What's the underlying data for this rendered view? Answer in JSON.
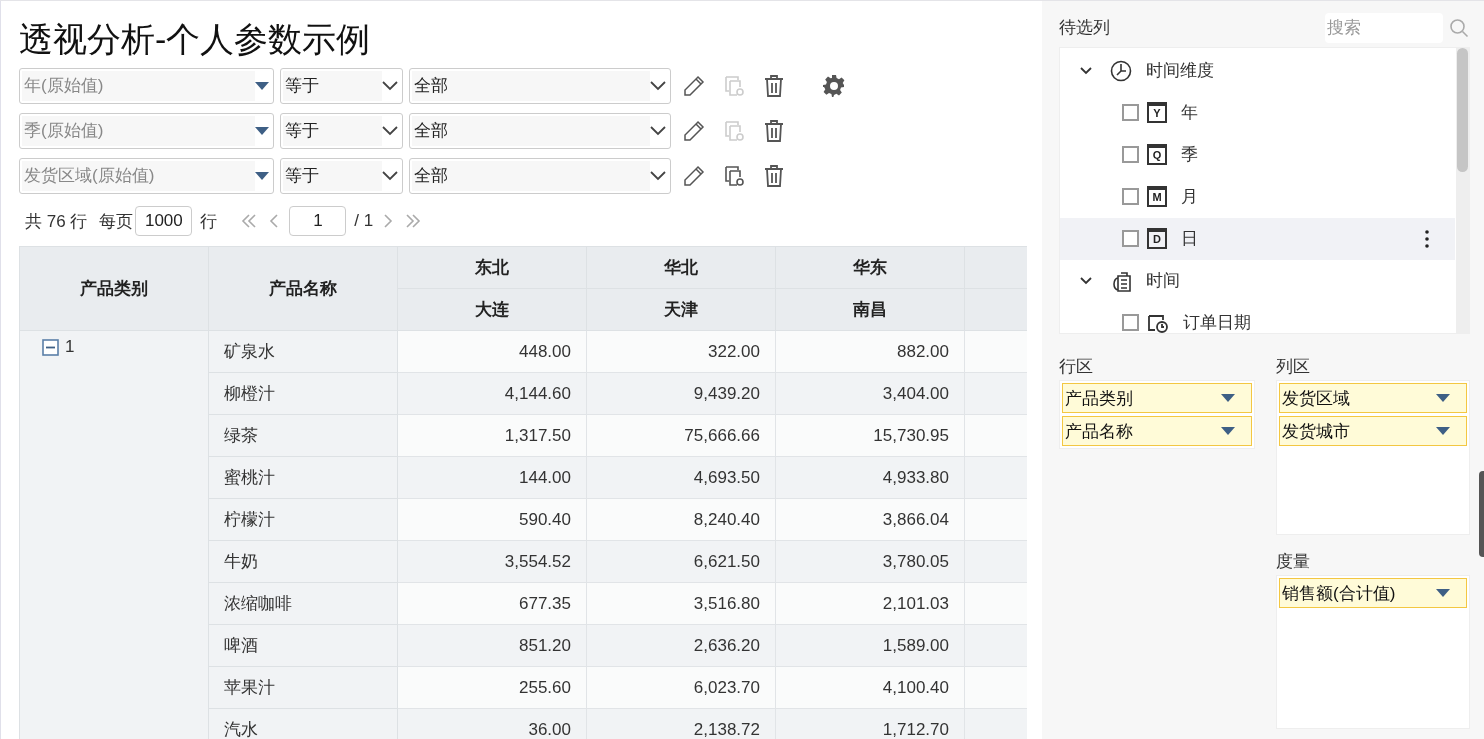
{
  "title": "透视分析-个人参数示例",
  "filters": [
    {
      "field": "年(原始值)",
      "operator": "等于",
      "value": "全部",
      "copy_disabled": true,
      "has_settings": true
    },
    {
      "field": "季(原始值)",
      "operator": "等于",
      "value": "全部",
      "copy_disabled": true,
      "has_settings": false
    },
    {
      "field": "发货区域(原始值)",
      "operator": "等于",
      "value": "全部",
      "copy_disabled": false,
      "has_settings": false
    }
  ],
  "pager": {
    "total": "共 76 行",
    "per_page_label": "每页",
    "per_page": "1000",
    "rows_unit": "行",
    "page": "1",
    "page_total": "/ 1"
  },
  "table": {
    "row_header_columns": [
      "产品类别",
      "产品名称"
    ],
    "column_groups": [
      {
        "region": "东北",
        "city": "大连"
      },
      {
        "region": "华北",
        "city": "天津"
      },
      {
        "region": "华东",
        "city": "南昌"
      }
    ],
    "category": {
      "label": "1",
      "expanded": true
    },
    "rows": [
      {
        "name": "矿泉水",
        "values": [
          "448.00",
          "322.00",
          "882.00"
        ]
      },
      {
        "name": "柳橙汁",
        "values": [
          "4,144.60",
          "9,439.20",
          "3,404.00"
        ]
      },
      {
        "name": "绿茶",
        "values": [
          "1,317.50",
          "75,666.66",
          "15,730.95"
        ]
      },
      {
        "name": "蜜桃汁",
        "values": [
          "144.00",
          "4,693.50",
          "4,933.80"
        ]
      },
      {
        "name": "柠檬汁",
        "values": [
          "590.40",
          "8,240.40",
          "3,866.04"
        ]
      },
      {
        "name": "牛奶",
        "values": [
          "3,554.52",
          "6,621.50",
          "3,780.05"
        ]
      },
      {
        "name": "浓缩咖啡",
        "values": [
          "677.35",
          "3,516.80",
          "2,101.03"
        ]
      },
      {
        "name": "啤酒",
        "values": [
          "851.20",
          "2,636.20",
          "1,589.00"
        ]
      },
      {
        "name": "苹果汁",
        "values": [
          "255.60",
          "6,023.70",
          "4,100.40"
        ]
      },
      {
        "name": "汽水",
        "values": [
          "36.00",
          "2,138.72",
          "1,712.70"
        ]
      }
    ]
  },
  "candidates": {
    "title": "待选列",
    "search_placeholder": "搜索",
    "tree": [
      {
        "label": "时间维度",
        "kind": "dimension",
        "expanded": true,
        "children": [
          {
            "label": "年",
            "kind": "period",
            "glyph": "Y",
            "checked": false,
            "selected": false
          },
          {
            "label": "季",
            "kind": "period",
            "glyph": "Q",
            "checked": false,
            "selected": false
          },
          {
            "label": "月",
            "kind": "period",
            "glyph": "M",
            "checked": false,
            "selected": false
          },
          {
            "label": "日",
            "kind": "period",
            "glyph": "D",
            "checked": false,
            "selected": true
          }
        ]
      },
      {
        "label": "时间",
        "kind": "folder",
        "expanded": true,
        "children": [
          {
            "label": "订单日期",
            "kind": "date",
            "checked": false,
            "selected": false
          }
        ]
      }
    ]
  },
  "row_zone": {
    "title": "行区",
    "fields": [
      "产品类别",
      "产品名称"
    ]
  },
  "column_zone": {
    "title": "列区",
    "fields": [
      "发货区域",
      "发货城市"
    ]
  },
  "measure_zone": {
    "title": "度量",
    "fields": [
      "销售额(合计值)"
    ]
  }
}
